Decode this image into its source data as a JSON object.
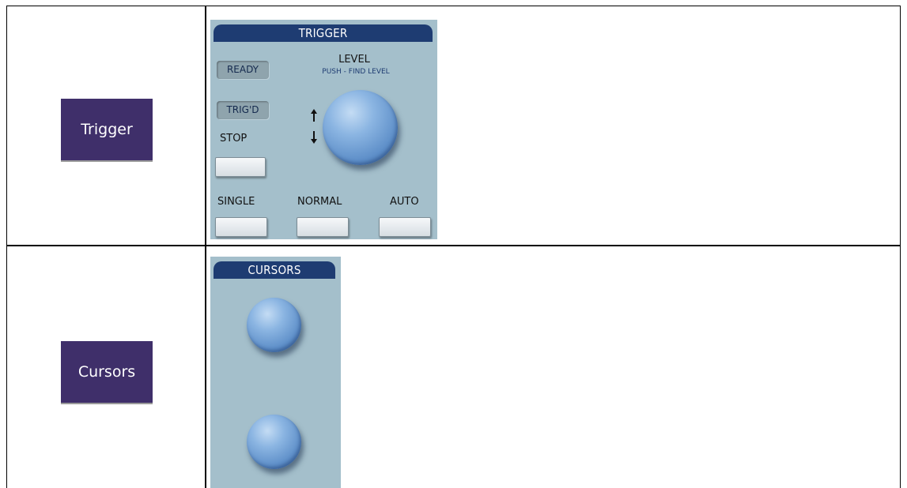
{
  "rows": [
    {
      "label": "Trigger",
      "panel": {
        "title": "TRIGGER",
        "indicators": [
          "READY",
          "TRIG'D"
        ],
        "stop_label": "STOP",
        "level_label": "LEVEL",
        "level_sublabel": "PUSH - FIND LEVEL",
        "mode_labels": [
          "SINGLE",
          "NORMAL",
          "AUTO"
        ],
        "knob_icon": "knob-icon",
        "arrow_icons": [
          "arrow-up-icon",
          "arrow-down-icon"
        ]
      }
    },
    {
      "label": "Cursors",
      "panel": {
        "title": "CURSORS",
        "knob_icon": "knob-icon"
      }
    }
  ],
  "colors": {
    "label_background": "#3f2f6a",
    "panel_background": "#a4bfcb",
    "panel_header": "#1e3c72",
    "knob": "#6b9bd2",
    "indicator": "#8fa4ad"
  }
}
